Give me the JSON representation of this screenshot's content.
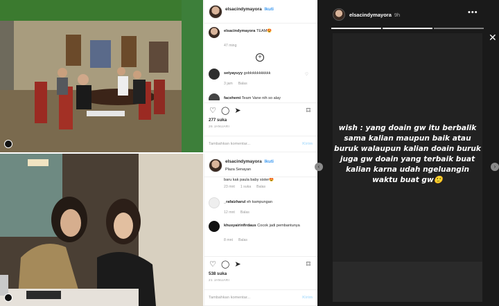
{
  "post1": {
    "username": "elsacindymayora",
    "follow_label": "Ikuti",
    "caption_user": "elsacindymayora",
    "caption_text": "TEAM😍",
    "caption_time": "47 ming",
    "comments": [
      {
        "user": "setyayuyy",
        "text": "goblokkkkkkkkk",
        "time": "3 jam",
        "reply": "Balas"
      },
      {
        "user": "facehemi",
        "text": "Team Vane nih so alay",
        "time": "",
        "reply": ""
      }
    ],
    "likes": "277 suka",
    "date": "26 JANUARI",
    "comment_placeholder": "Tambahkan komentar...",
    "post_label": "Kirim"
  },
  "post2": {
    "username": "elsacindymayora",
    "follow_label": "Ikuti",
    "location": "Plaza Senayan",
    "top_comment_text": "baru kak paula baby sister😍",
    "top_comment_meta": {
      "time": "23 mnt",
      "likes": "1 suka",
      "reply": "Balas"
    },
    "comments": [
      {
        "user": "_rafaizharul",
        "text": "eh kampungan",
        "time": "12 mnt",
        "reply": "Balas"
      },
      {
        "user": "khusyairinfirdaus",
        "text": "Cocok jadi pembantunya",
        "time": "8 mnt",
        "reply": "Balas"
      }
    ],
    "likes": "538 suka",
    "date": "21 JANUARI",
    "comment_placeholder": "Tambahkan komentar...",
    "post_label": "Kirim"
  },
  "story": {
    "username": "elsacindymayora",
    "time": "9h",
    "message": "wish : yang doain gw itu berbalik sama kalian maupun baik atau buruk walaupun kalian doain buruk juga gw doain yang terbaik buat kalian karna udah ngeluangin waktu buat gw🙂"
  }
}
